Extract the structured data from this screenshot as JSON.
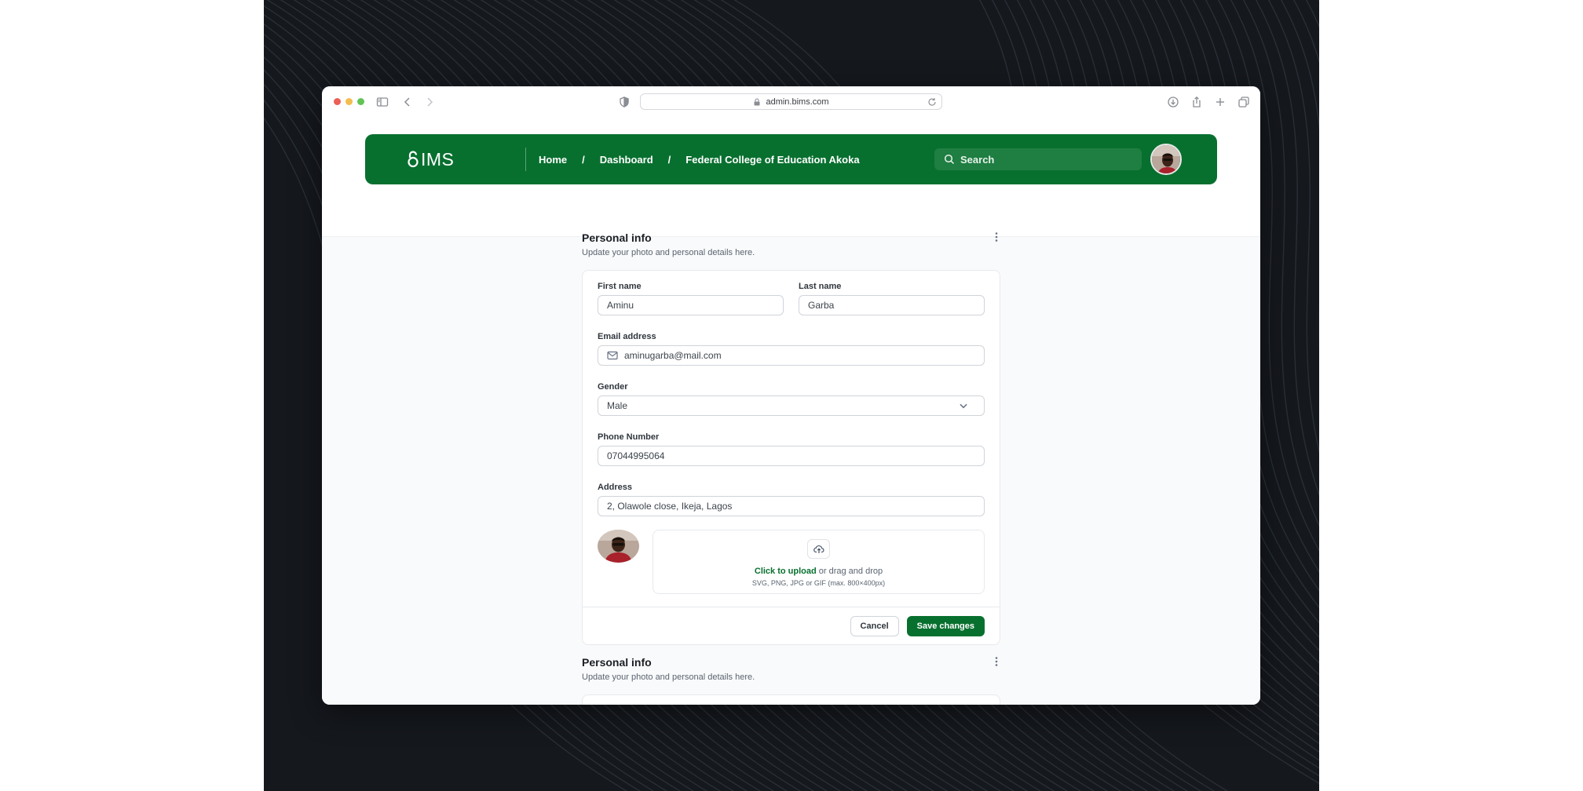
{
  "browser": {
    "url": "admin.bims.com"
  },
  "navbar": {
    "logo_text": "IMS",
    "breadcrumb": [
      {
        "label": "Home"
      },
      {
        "label": "Dashboard"
      },
      {
        "label": "Federal College of Education Akoka"
      }
    ],
    "breadcrumb_separator": "/",
    "search_label": "Search"
  },
  "personal_info": {
    "title": "Personal info",
    "subtitle": "Update your photo and personal details here.",
    "first_name": {
      "label": "First name",
      "value": "Aminu"
    },
    "last_name": {
      "label": "Last name",
      "value": "Garba"
    },
    "email": {
      "label": "Email address",
      "value": "aminugarba@mail.com"
    },
    "gender": {
      "label": "Gender",
      "value": "Male"
    },
    "phone": {
      "label": "Phone Number",
      "value": "07044995064"
    },
    "address": {
      "label": "Address",
      "value": "2, Olawole close, Ikeja, Lagos"
    },
    "upload": {
      "link_text": "Click to upload",
      "rest_text": " or drag and drop",
      "hint": "SVG, PNG, JPG or GIF (max. 800×400px)"
    },
    "cancel_label": "Cancel",
    "save_label": "Save changes"
  },
  "personal_info_2": {
    "title": "Personal info",
    "subtitle": "Update your photo and personal details here."
  },
  "colors": {
    "brand_green": "#08702f",
    "backdrop": "#15181d"
  },
  "icons": [
    "sidebar-icon",
    "back-icon",
    "forward-icon",
    "shield-icon",
    "lock-icon",
    "reload-icon",
    "download-icon",
    "share-icon",
    "plus-icon",
    "tabs-icon",
    "search-icon",
    "mail-icon",
    "chevron-down-icon",
    "upload-cloud-icon",
    "kebab-icon"
  ]
}
